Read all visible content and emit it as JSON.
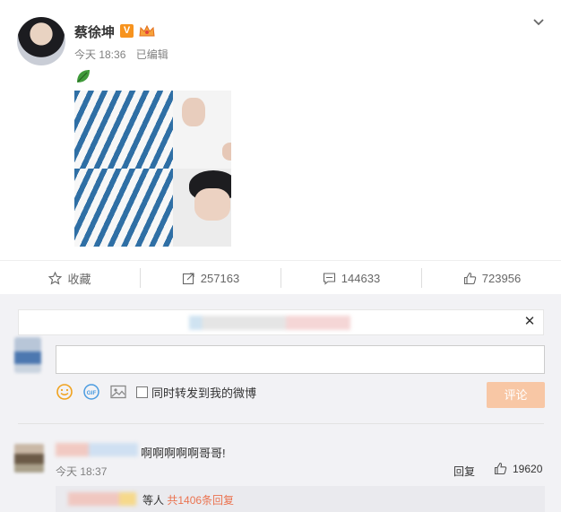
{
  "post": {
    "username": "蔡徐坤",
    "verified_badge": "V",
    "time": "今天 18:36",
    "edited": "已编辑"
  },
  "actions": {
    "favorite": "收藏",
    "repost_count": "257163",
    "comment_count": "144633",
    "like_count": "723956"
  },
  "composer": {
    "repost_option": "同时转发到我的微博",
    "submit": "评论"
  },
  "comment": {
    "text": "啊啊啊啊啊哥哥!",
    "time": "今天 18:37",
    "reply": "回复",
    "likes": "19620",
    "replies_prefix": "等人",
    "replies_link": "共1406条回复"
  },
  "colors": {
    "accent": "#eb7350",
    "verified": "#f7931e",
    "disabled_button": "#f8c7a5"
  }
}
